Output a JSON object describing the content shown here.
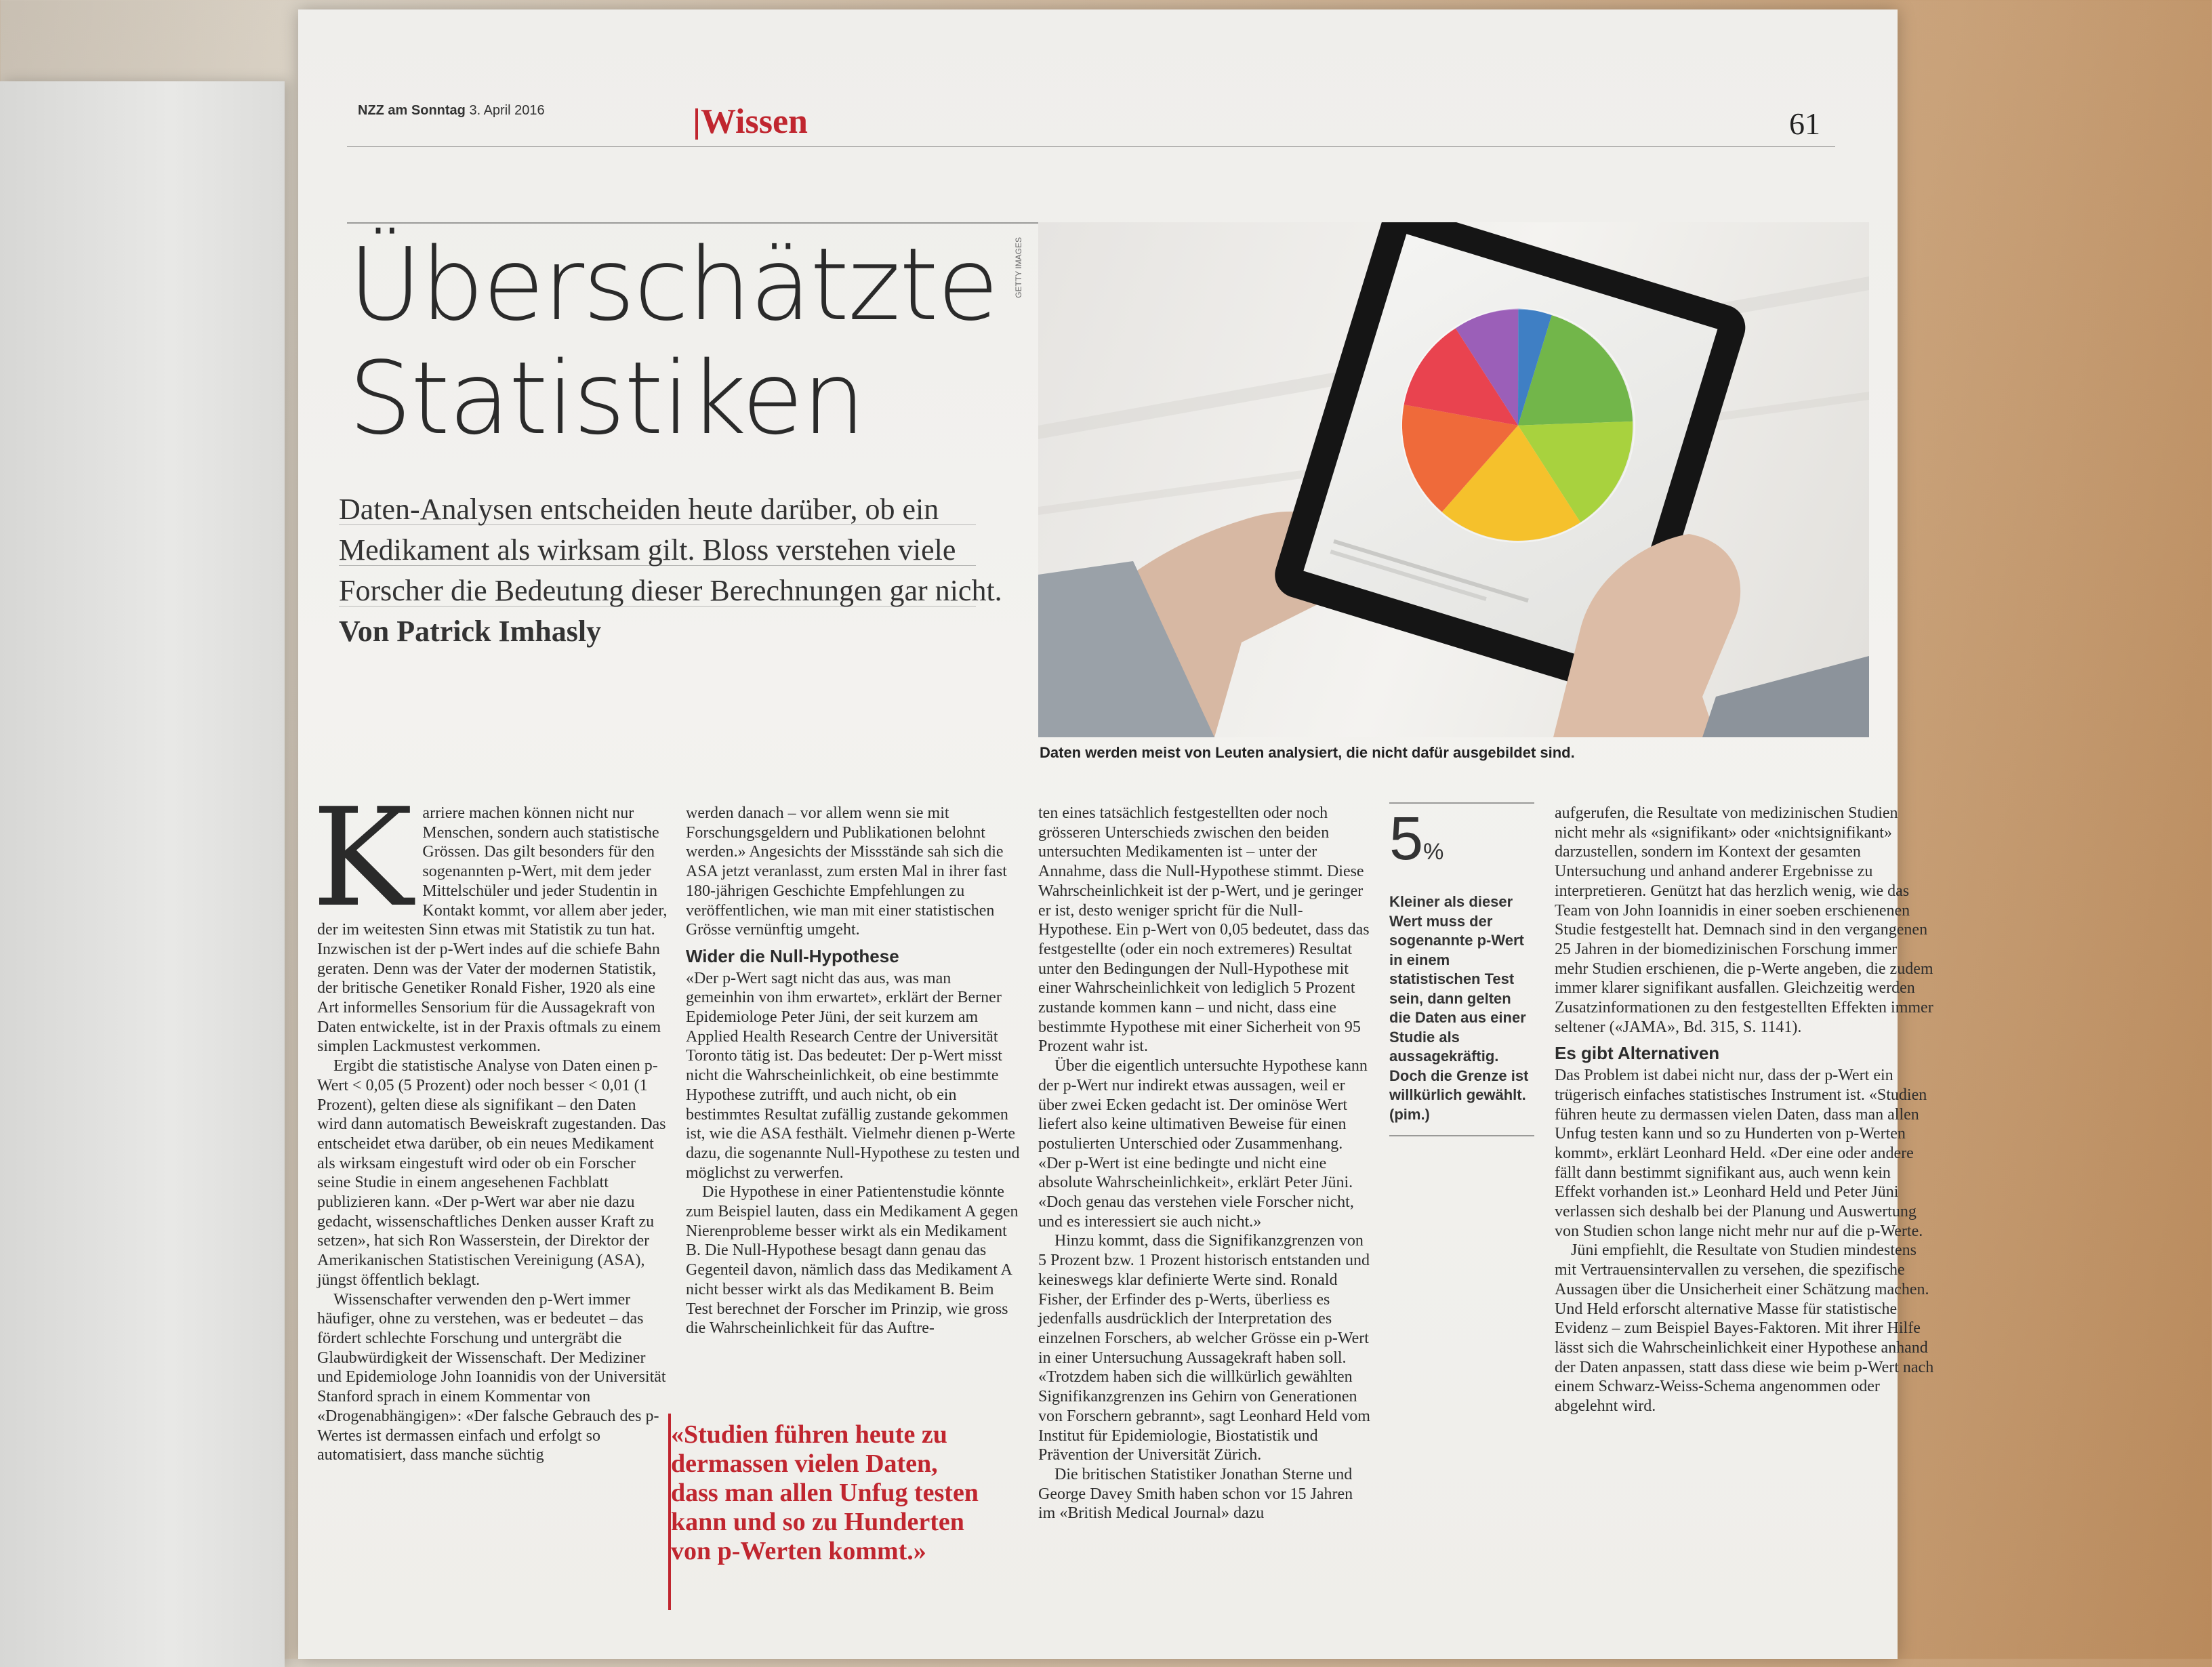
{
  "masthead": {
    "paper": "NZZ am Sonntag",
    "date": "3. April 2016"
  },
  "section": "Wissen",
  "page_number": "61",
  "headline": [
    "Überschätzte",
    "Statistiken"
  ],
  "lead": {
    "text": "Daten-Analysen entscheiden heute darüber, ob ein Medikament als wirksam gilt. Bloss verstehen viele Forscher die Bedeutung dieser Berechnungen gar nicht.",
    "author": "Von Patrick Imhasly"
  },
  "photo": {
    "credit": "GETTY IMAGES",
    "caption": "Daten werden meist von Leuten analysiert, die nicht dafür ausgebildet sind."
  },
  "column1": {
    "dropcap": "K",
    "p1": "arriere machen können nicht nur Menschen, sondern auch statistische Grössen. Das gilt besonders für den sogenannten p-Wert, mit dem jeder Mittelschüler und jeder Studentin in Kontakt kommt, vor allem aber jeder, der im weitesten Sinn etwas mit Statistik zu tun hat. Inzwischen ist der p-Wert indes auf die schiefe Bahn geraten. Denn was der Vater der modernen Statistik, der britische Genetiker Ronald Fisher, 1920 als eine Art informelles Sensorium für die Aussagekraft von Daten entwickelte, ist in der Praxis oftmals zu einem simplen Lackmustest verkommen.",
    "p2": "Ergibt die statistische Analyse von Daten einen p-Wert < 0,05 (5 Prozent) oder noch besser < 0,01 (1 Prozent), gelten diese als signifikant – den Daten wird dann automatisch Beweiskraft zugestanden. Das entscheidet etwa darüber, ob ein neues Medikament als wirksam eingestuft wird oder ob ein Forscher seine Studie in einem angesehenen Fachblatt publizieren kann. «Der p-Wert war aber nie dazu gedacht, wissenschaftliches Denken ausser Kraft zu setzen», hat sich Ron Wasserstein, der Direktor der Amerikanischen Statistischen Vereinigung (ASA), jüngst öffentlich beklagt.",
    "p3": "Wissenschafter verwenden den p-Wert immer häufiger, ohne zu verstehen, was er bedeutet – das fördert schlechte Forschung und untergräbt die Glaubwürdigkeit der Wissenschaft. Der Mediziner und Epidemiologe John Ioannidis von der Universität Stanford sprach in einem Kommentar von «Drogenabhängigen»: «Der falsche Gebrauch des p-Wertes ist dermassen einfach und erfolgt so automatisiert, dass manche süchtig"
  },
  "column2": {
    "p1": "werden danach – vor allem wenn sie mit Forschungsgeldern und Publikationen belohnt werden.» Angesichts der Missstände sah sich die ASA jetzt veranlasst, zum ersten Mal in ihrer fast 180-jährigen Geschichte Empfehlungen zu veröffentlichen, wie man mit einer statistischen Grösse vernünftig umgeht.",
    "heading": "Wider die Null-Hypothese",
    "p2": "«Der p-Wert sagt nicht das aus, was man gemeinhin von ihm erwartet», erklärt der Berner Epidemiologe Peter Jüni, der seit kurzem am Applied Health Research Centre der Universität Toronto tätig ist. Das bedeutet: Der p-Wert misst nicht die Wahrscheinlichkeit, ob eine bestimmte Hypothese zutrifft, und auch nicht, ob ein bestimmtes Resultat zufällig zustande gekommen ist, wie die ASA festhält. Vielmehr dienen p-Werte dazu, die sogenannte Null-Hypothese zu testen und möglichst zu verwerfen.",
    "p3": "Die Hypothese in einer Patientenstudie könnte zum Beispiel lauten, dass ein Medikament A gegen Nierenprobleme besser wirkt als ein Medikament B. Die Null-Hypothese besagt dann genau das Gegenteil davon, nämlich dass das Medikament A nicht besser wirkt als das Medikament B. Beim Test berechnet der Forscher im Prinzip, wie gross die Wahrscheinlichkeit für das Auftre-",
    "pullquote": "«Studien führen heute zu dermassen vielen Daten, dass man allen Unfug testen kann und so zu Hunderten von p-Werten kommt.»"
  },
  "column3": {
    "p1": "ten eines tatsächlich festgestellten oder noch grösseren Unterschieds zwischen den beiden untersuchten Medikamenten ist – unter der Annahme, dass die Null-Hypothese stimmt. Diese Wahrscheinlichkeit ist der p-Wert, und je geringer er ist, desto weniger spricht für die Null-Hypothese. Ein p-Wert von 0,05 bedeutet, dass das festgestellte (oder ein noch extremeres) Resultat unter den Bedingungen der Null-Hypothese mit einer Wahrscheinlichkeit von lediglich 5 Prozent zustande kommen kann – und nicht, dass eine bestimmte Hypothese mit einer Sicherheit von 95 Prozent wahr ist.",
    "p2": "Über die eigentlich untersuchte Hypothese kann der p-Wert nur indirekt etwas aussagen, weil er über zwei Ecken gedacht ist. Der ominöse Wert liefert also keine ultimativen Beweise für einen postulierten Unterschied oder Zusammenhang. «Der p-Wert ist eine bedingte und nicht eine absolute Wahrscheinlichkeit», erklärt Peter Jüni. «Doch genau das verstehen viele Forscher nicht, und es interessiert sie auch nicht.»",
    "p3": "Hinzu kommt, dass die Signifikanzgrenzen von 5 Prozent bzw. 1 Prozent historisch entstanden und keineswegs klar definierte Werte sind. Ronald Fisher, der Erfinder des p-Werts, überliess es jedenfalls ausdrücklich der Interpretation des einzelnen Forschers, ab welcher Grösse ein p-Wert in einer Untersuchung Aussagekraft haben soll. «Trotzdem haben sich die willkürlich gewählten Signifikanzgrenzen ins Gehirn von Generationen von Forschern gebrannt», sagt Leonhard Held vom Institut für Epidemiologie, Biostatistik und Prävention der Universität Zürich.",
    "p4": "Die britischen Statistiker Jonathan Sterne und George Davey Smith haben schon vor 15 Jahren im «British Medical Journal» dazu"
  },
  "factbox": {
    "number": "5",
    "unit": "%",
    "text": "Kleiner als dieser Wert muss der sogenannte p-Wert in einem statistischen Test sein, dann gelten die Daten aus einer Studie als aussagekräftig. Doch die Grenze ist willkürlich gewählt. (pim.)"
  },
  "column5": {
    "p1": "aufgerufen, die Resultate von medizinischen Studien nicht mehr als «signifikant» oder «nichtsignifikant» darzustellen, sondern im Kontext der gesamten Untersuchung und anhand anderer Ergebnisse zu interpretieren. Genützt hat das herzlich wenig, wie das Team von John Ioannidis in einer soeben erschienenen Studie festgestellt hat. Demnach sind in den vergangenen 25 Jahren in der biomedizinischen Forschung immer mehr Studien erschienen, die p-Werte angeben, die zudem immer klarer signifikant ausfallen. Gleichzeitig werden Zusatzinformationen zu den festgestellten Effekten immer seltener («JAMA», Bd. 315, S. 1141).",
    "heading": "Es gibt Alternativen",
    "p2": "Das Problem ist dabei nicht nur, dass der p-Wert ein trügerisch einfaches statistisches Instrument ist. «Studien führen heute zu dermassen vielen Daten, dass man allen Unfug testen kann und so zu Hunderten von p-Werten kommt», erklärt Leonhard Held. «Der eine oder andere fällt dann bestimmt signifikant aus, auch wenn kein Effekt vorhanden ist.» Leonhard Held und Peter Jüni verlassen sich deshalb bei der Planung und Auswertung von Studien schon lange nicht mehr nur auf die p-Werte.",
    "p3": "Jüni empfiehlt, die Resultate von Studien mindestens mit Vertrauensintervallen zu versehen, die spezifische Aussagen über die Unsicherheit einer Schätzung machen. Und Held erforscht alternative Masse für statistische Evidenz – zum Beispiel Bayes-Faktoren. Mit ihrer Hilfe lässt sich die Wahrscheinlichkeit einer Hypothese anhand der Daten anpassen, statt dass diese wie beim p-Wert nach einem Schwarz-Weiss-Schema angenommen oder abgelehnt wird."
  },
  "colors": {
    "accent": "#c0262f",
    "text": "#2c2c2c",
    "paper": "#f1f0ed",
    "table": "#c9a27a"
  }
}
